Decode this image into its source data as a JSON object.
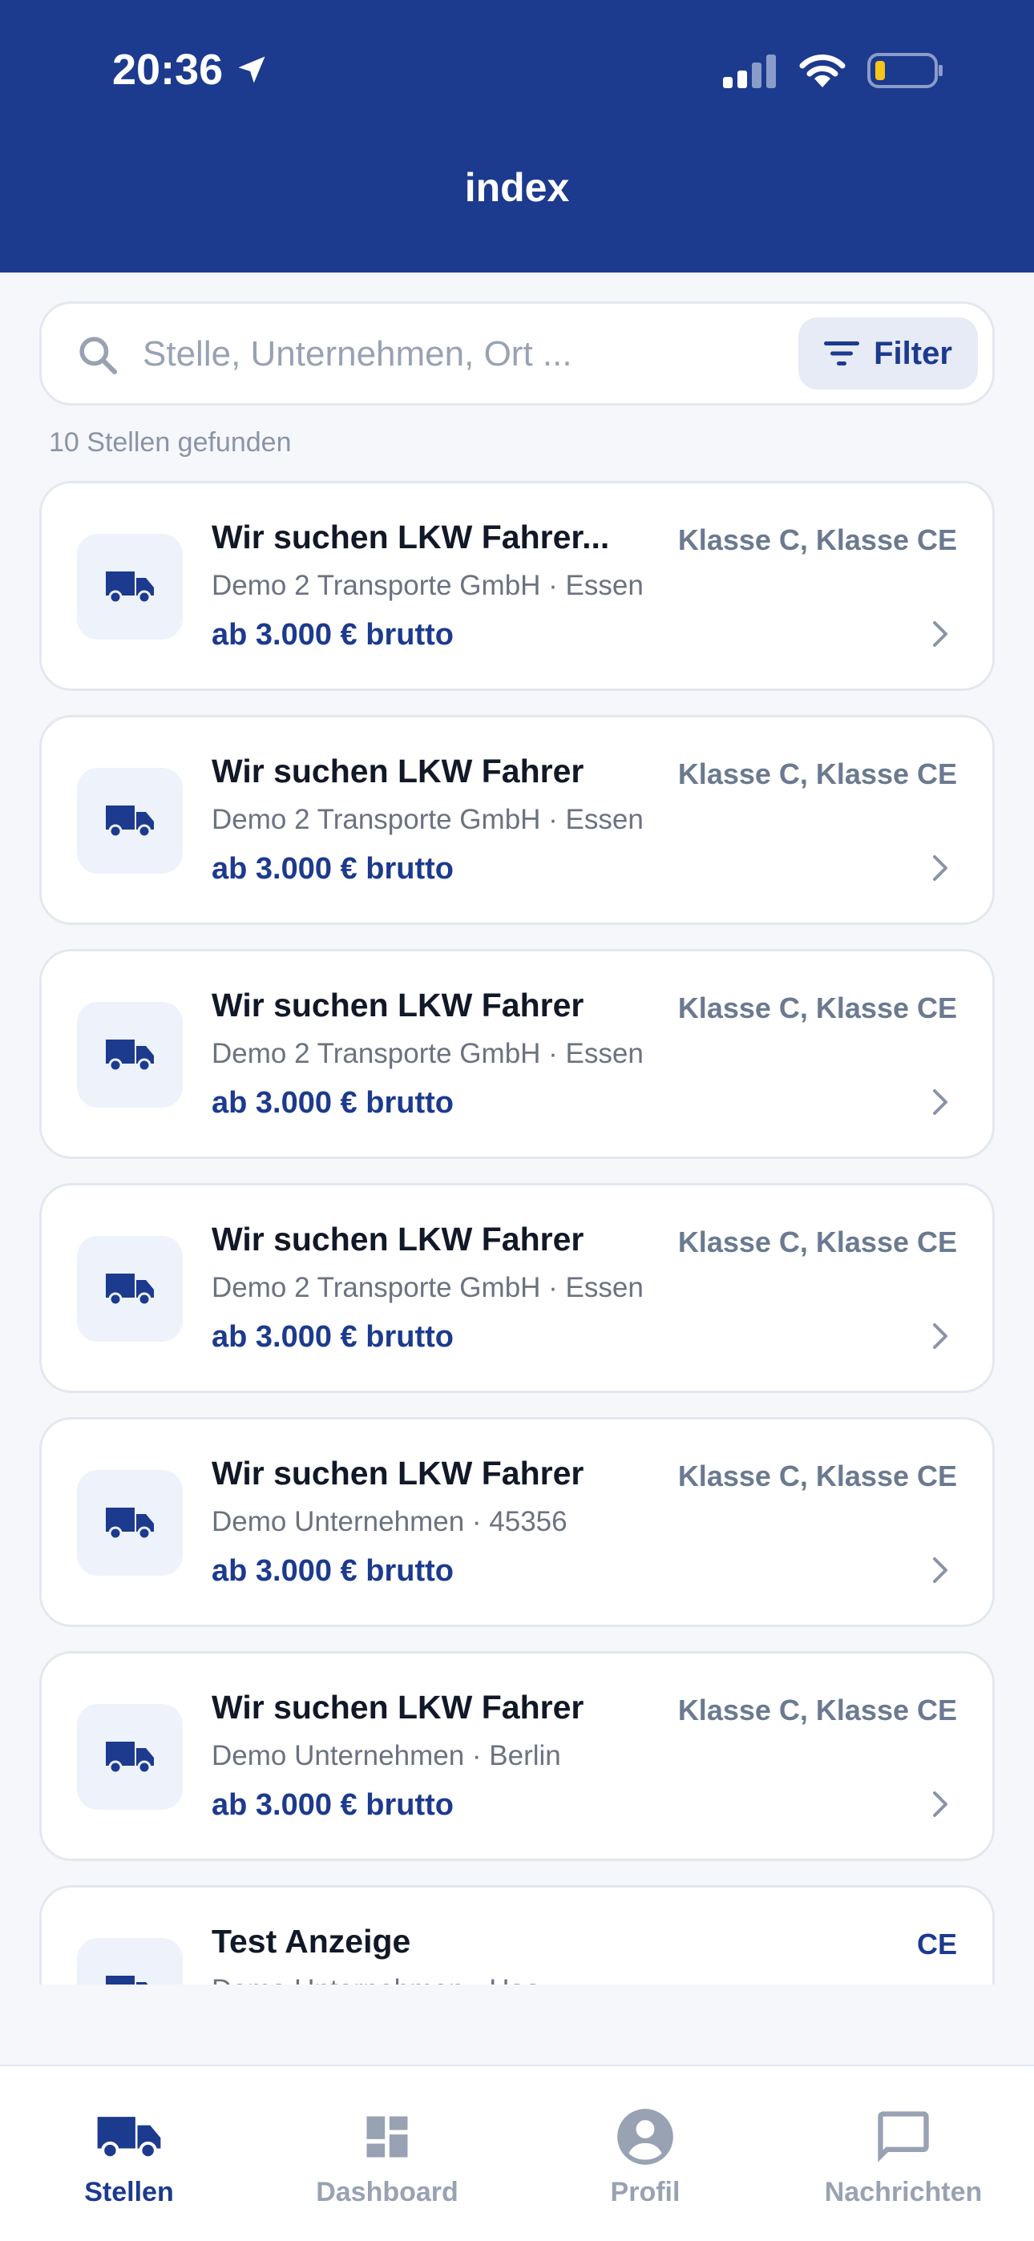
{
  "status_bar": {
    "time": "20:36"
  },
  "header": {
    "title": "index"
  },
  "search": {
    "placeholder": "Stelle, Unternehmen, Ort ...",
    "value": "",
    "filter_label": "Filter"
  },
  "results": {
    "count_text": "10 Stellen gefunden"
  },
  "jobs": [
    {
      "title": "Wir suchen LKW Fahrer...",
      "classes": "Klasse C, Klasse CE",
      "company": "Demo 2 Transporte GmbH · Essen",
      "salary": "ab 3.000 € brutto"
    },
    {
      "title": "Wir suchen LKW Fahrer",
      "classes": "Klasse C, Klasse CE",
      "company": "Demo 2 Transporte GmbH · Essen",
      "salary": "ab 3.000 € brutto"
    },
    {
      "title": "Wir suchen LKW Fahrer",
      "classes": "Klasse C, Klasse CE",
      "company": "Demo 2 Transporte GmbH · Essen",
      "salary": "ab 3.000 € brutto"
    },
    {
      "title": "Wir suchen LKW Fahrer",
      "classes": "Klasse C, Klasse CE",
      "company": "Demo 2 Transporte GmbH · Essen",
      "salary": "ab 3.000 € brutto"
    },
    {
      "title": "Wir suchen LKW Fahrer",
      "classes": "Klasse C, Klasse CE",
      "company": "Demo Unternehmen · 45356",
      "salary": "ab 3.000 € brutto"
    },
    {
      "title": "Wir suchen LKW Fahrer",
      "classes": "Klasse C, Klasse CE",
      "company": "Demo Unternehmen · Berlin",
      "salary": "ab 3.000 € brutto"
    },
    {
      "title": "Test Anzeige",
      "classes": "CE",
      "company": "Demo Unternehmen · Haa",
      "salary": ""
    }
  ],
  "tabs": [
    {
      "label": "Stellen",
      "icon": "truck-icon",
      "active": true
    },
    {
      "label": "Dashboard",
      "icon": "dashboard-icon",
      "active": false
    },
    {
      "label": "Profil",
      "icon": "profile-icon",
      "active": false
    },
    {
      "label": "Nachrichten",
      "icon": "message-icon",
      "active": false
    }
  ],
  "colors": {
    "primary": "#1c3a8e",
    "muted": "#98a2b3",
    "battery": "#f5c518"
  }
}
